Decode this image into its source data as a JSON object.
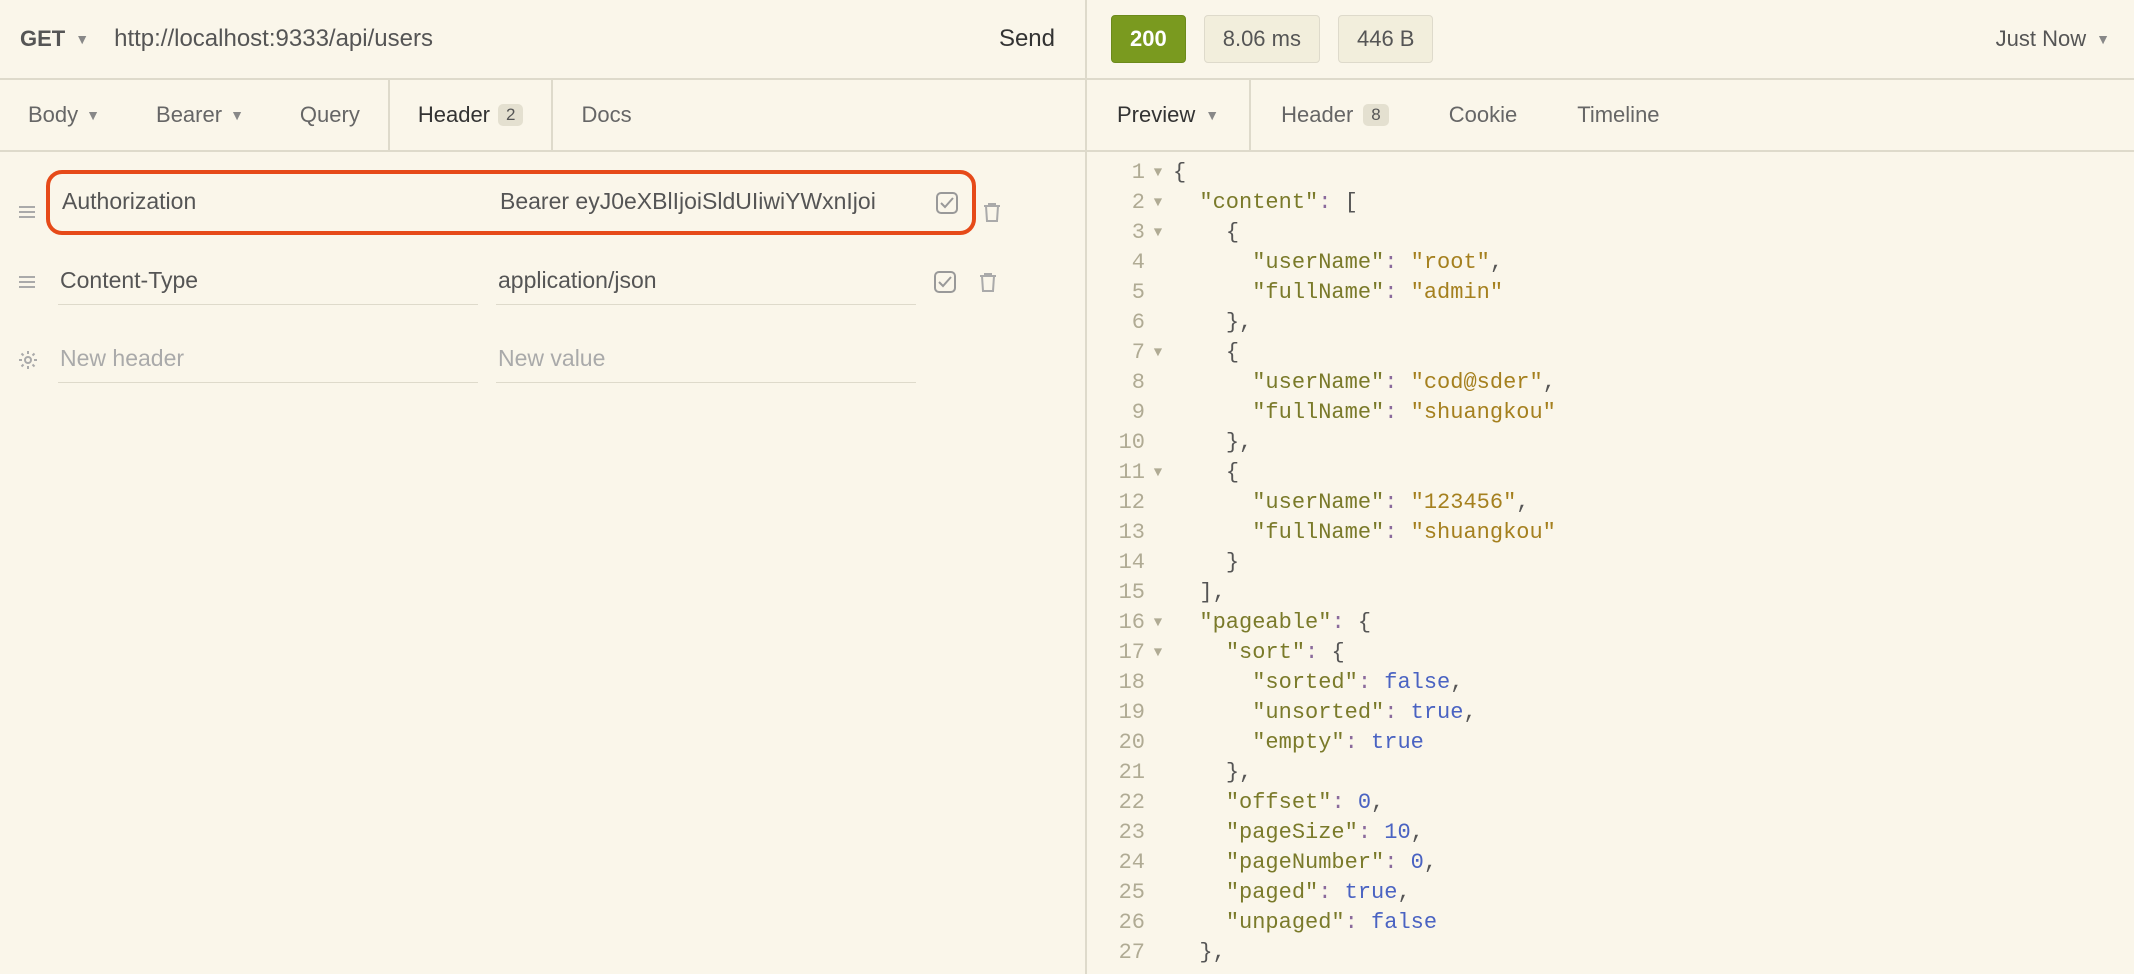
{
  "request": {
    "method": "GET",
    "url": "http://localhost:9333/api/users",
    "send_label": "Send",
    "tabs": {
      "body": "Body",
      "auth": "Bearer",
      "query": "Query",
      "header": "Header",
      "header_count": "2",
      "docs": "Docs"
    },
    "headers": [
      {
        "name": "Authorization",
        "value": "Bearer eyJ0eXBlIjoiSldUIiwiYWxnIjoi"
      },
      {
        "name": "Content-Type",
        "value": "application/json"
      }
    ],
    "new_header_placeholder": "New header",
    "new_value_placeholder": "New value"
  },
  "response": {
    "status_code": "200",
    "time": "8.06 ms",
    "size": "446 B",
    "timestamp_label": "Just Now",
    "tabs": {
      "preview": "Preview",
      "header": "Header",
      "header_count": "8",
      "cookie": "Cookie",
      "timeline": "Timeline"
    },
    "json_lines": [
      {
        "n": 1,
        "fold": true,
        "indent": 0,
        "tokens": [
          [
            "brace",
            "{"
          ]
        ]
      },
      {
        "n": 2,
        "fold": true,
        "indent": 1,
        "tokens": [
          [
            "key",
            "\"content\""
          ],
          [
            "punct",
            ": "
          ],
          [
            "brace",
            "["
          ]
        ]
      },
      {
        "n": 3,
        "fold": true,
        "indent": 2,
        "tokens": [
          [
            "brace",
            "{"
          ]
        ]
      },
      {
        "n": 4,
        "fold": false,
        "indent": 3,
        "tokens": [
          [
            "key",
            "\"userName\""
          ],
          [
            "punct",
            ": "
          ],
          [
            "str",
            "\"root\""
          ],
          [
            "brace",
            ","
          ]
        ]
      },
      {
        "n": 5,
        "fold": false,
        "indent": 3,
        "tokens": [
          [
            "key",
            "\"fullName\""
          ],
          [
            "punct",
            ": "
          ],
          [
            "str",
            "\"admin\""
          ]
        ]
      },
      {
        "n": 6,
        "fold": false,
        "indent": 2,
        "tokens": [
          [
            "brace",
            "},"
          ]
        ]
      },
      {
        "n": 7,
        "fold": true,
        "indent": 2,
        "tokens": [
          [
            "brace",
            "{"
          ]
        ]
      },
      {
        "n": 8,
        "fold": false,
        "indent": 3,
        "tokens": [
          [
            "key",
            "\"userName\""
          ],
          [
            "punct",
            ": "
          ],
          [
            "str",
            "\"cod@sder\""
          ],
          [
            "brace",
            ","
          ]
        ]
      },
      {
        "n": 9,
        "fold": false,
        "indent": 3,
        "tokens": [
          [
            "key",
            "\"fullName\""
          ],
          [
            "punct",
            ": "
          ],
          [
            "str",
            "\"shuangkou\""
          ]
        ]
      },
      {
        "n": 10,
        "fold": false,
        "indent": 2,
        "tokens": [
          [
            "brace",
            "},"
          ]
        ]
      },
      {
        "n": 11,
        "fold": true,
        "indent": 2,
        "tokens": [
          [
            "brace",
            "{"
          ]
        ]
      },
      {
        "n": 12,
        "fold": false,
        "indent": 3,
        "tokens": [
          [
            "key",
            "\"userName\""
          ],
          [
            "punct",
            ": "
          ],
          [
            "str",
            "\"123456\""
          ],
          [
            "brace",
            ","
          ]
        ]
      },
      {
        "n": 13,
        "fold": false,
        "indent": 3,
        "tokens": [
          [
            "key",
            "\"fullName\""
          ],
          [
            "punct",
            ": "
          ],
          [
            "str",
            "\"shuangkou\""
          ]
        ]
      },
      {
        "n": 14,
        "fold": false,
        "indent": 2,
        "tokens": [
          [
            "brace",
            "}"
          ]
        ]
      },
      {
        "n": 15,
        "fold": false,
        "indent": 1,
        "tokens": [
          [
            "brace",
            "],"
          ]
        ]
      },
      {
        "n": 16,
        "fold": true,
        "indent": 1,
        "tokens": [
          [
            "key",
            "\"pageable\""
          ],
          [
            "punct",
            ": "
          ],
          [
            "brace",
            "{"
          ]
        ]
      },
      {
        "n": 17,
        "fold": true,
        "indent": 2,
        "tokens": [
          [
            "key",
            "\"sort\""
          ],
          [
            "punct",
            ": "
          ],
          [
            "brace",
            "{"
          ]
        ]
      },
      {
        "n": 18,
        "fold": false,
        "indent": 3,
        "tokens": [
          [
            "key",
            "\"sorted\""
          ],
          [
            "punct",
            ": "
          ],
          [
            "bool",
            "false"
          ],
          [
            "brace",
            ","
          ]
        ]
      },
      {
        "n": 19,
        "fold": false,
        "indent": 3,
        "tokens": [
          [
            "key",
            "\"unsorted\""
          ],
          [
            "punct",
            ": "
          ],
          [
            "bool",
            "true"
          ],
          [
            "brace",
            ","
          ]
        ]
      },
      {
        "n": 20,
        "fold": false,
        "indent": 3,
        "tokens": [
          [
            "key",
            "\"empty\""
          ],
          [
            "punct",
            ": "
          ],
          [
            "bool",
            "true"
          ]
        ]
      },
      {
        "n": 21,
        "fold": false,
        "indent": 2,
        "tokens": [
          [
            "brace",
            "},"
          ]
        ]
      },
      {
        "n": 22,
        "fold": false,
        "indent": 2,
        "tokens": [
          [
            "key",
            "\"offset\""
          ],
          [
            "punct",
            ": "
          ],
          [
            "num",
            "0"
          ],
          [
            "brace",
            ","
          ]
        ]
      },
      {
        "n": 23,
        "fold": false,
        "indent": 2,
        "tokens": [
          [
            "key",
            "\"pageSize\""
          ],
          [
            "punct",
            ": "
          ],
          [
            "num",
            "10"
          ],
          [
            "brace",
            ","
          ]
        ]
      },
      {
        "n": 24,
        "fold": false,
        "indent": 2,
        "tokens": [
          [
            "key",
            "\"pageNumber\""
          ],
          [
            "punct",
            ": "
          ],
          [
            "num",
            "0"
          ],
          [
            "brace",
            ","
          ]
        ]
      },
      {
        "n": 25,
        "fold": false,
        "indent": 2,
        "tokens": [
          [
            "key",
            "\"paged\""
          ],
          [
            "punct",
            ": "
          ],
          [
            "bool",
            "true"
          ],
          [
            "brace",
            ","
          ]
        ]
      },
      {
        "n": 26,
        "fold": false,
        "indent": 2,
        "tokens": [
          [
            "key",
            "\"unpaged\""
          ],
          [
            "punct",
            ": "
          ],
          [
            "bool",
            "false"
          ]
        ]
      },
      {
        "n": 27,
        "fold": false,
        "indent": 1,
        "tokens": [
          [
            "brace",
            "},"
          ]
        ]
      }
    ]
  }
}
